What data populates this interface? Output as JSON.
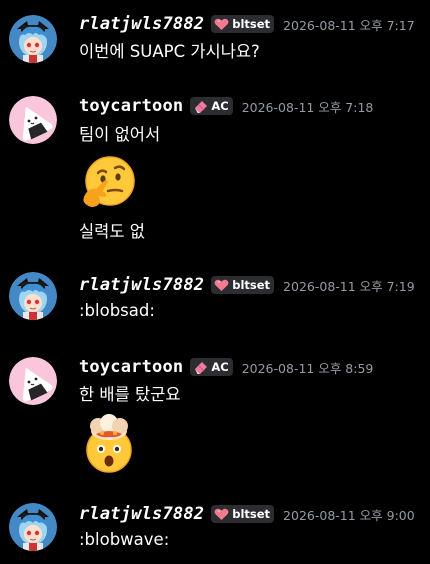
{
  "messages": [
    {
      "username": "rlatjwls7882",
      "tag": "bltset",
      "tag_icon": "heart-icon",
      "timestamp": "2026-08-11 오후 7:17",
      "lines": [
        "이번에 SUAPC 가시나요?"
      ]
    },
    {
      "username": "toycartoon",
      "tag": "AC",
      "tag_icon": "eraser-icon",
      "timestamp": "2026-08-11 오후 7:18",
      "lines": [
        "팀이 없어서",
        "실력도 없"
      ],
      "emoji": "thinking-face-emoji"
    },
    {
      "username": "rlatjwls7882",
      "tag": "bltset",
      "tag_icon": "heart-icon",
      "timestamp": "2026-08-11 오후 7:19",
      "lines": [
        ":blobsad:"
      ]
    },
    {
      "username": "toycartoon",
      "tag": "AC",
      "tag_icon": "eraser-icon",
      "timestamp": "2026-08-11 오후 8:59",
      "lines": [
        "한 배를 탔군요"
      ],
      "emoji": "exploding-head-emoji"
    },
    {
      "username": "rlatjwls7882",
      "tag": "bltset",
      "tag_icon": "heart-icon",
      "timestamp": "2026-08-11 오후 9:00",
      "lines": [
        ":blobwave:"
      ]
    }
  ],
  "colors": {
    "background": "#000000",
    "timestamp": "#949ba4",
    "tag_bg": "#2b2d31",
    "heart": "#f47b8f",
    "eraser": "#f07aa0"
  }
}
